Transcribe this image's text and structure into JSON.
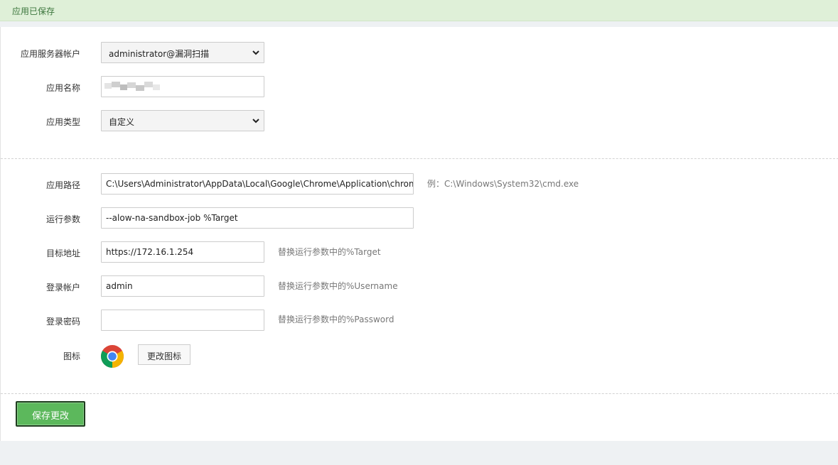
{
  "banner": {
    "message": "应用已保存"
  },
  "form": {
    "server_account": {
      "label": "应用服务器帐户",
      "value": "administrator@漏洞扫描"
    },
    "app_name": {
      "label": "应用名称",
      "value": ""
    },
    "app_type": {
      "label": "应用类型",
      "value": "自定义"
    },
    "app_path": {
      "label": "应用路径",
      "value": "C:\\Users\\Administrator\\AppData\\Local\\Google\\Chrome\\Application\\chrome.exe",
      "hint": "例：C:\\Windows\\System32\\cmd.exe"
    },
    "run_params": {
      "label": "运行参数",
      "value": "--alow-na-sandbox-job %Target"
    },
    "target_address": {
      "label": "目标地址",
      "value": "https://172.16.1.254",
      "hint": "替换运行参数中的%Target"
    },
    "login_account": {
      "label": "登录帐户",
      "value": "admin",
      "hint": "替换运行参数中的%Username"
    },
    "login_password": {
      "label": "登录密码",
      "value": "",
      "hint": "替换运行参数中的%Password"
    },
    "icon": {
      "label": "图标",
      "icon_name": "chrome-icon",
      "change_button": "更改图标"
    }
  },
  "actions": {
    "save_label": "保存更改"
  },
  "colors": {
    "banner_bg": "#dff0d8",
    "banner_text": "#3c763d",
    "save_button_bg": "#5cb85c",
    "page_bg": "#eef1f3"
  }
}
